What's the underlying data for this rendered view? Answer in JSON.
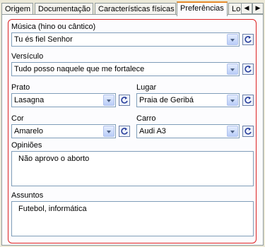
{
  "tabs": [
    {
      "label": "Origem"
    },
    {
      "label": "Documentação"
    },
    {
      "label": "Características físicas"
    },
    {
      "label": "Preferências"
    },
    {
      "label": "Lo"
    }
  ],
  "tab_scroll": {
    "left": "◀",
    "right": "▶"
  },
  "fields": {
    "musica": {
      "label": "Música (hino ou cântico)",
      "value": "Tu és fiel Senhor"
    },
    "versiculo": {
      "label": "Versículo",
      "value": "Tudo posso naquele que me fortalece"
    },
    "prato": {
      "label": "Prato",
      "value": "Lasagna"
    },
    "lugar": {
      "label": "Lugar",
      "value": "Praia de Geribá"
    },
    "cor": {
      "label": "Cor",
      "value": "Amarelo"
    },
    "carro": {
      "label": "Carro",
      "value": "Audi A3"
    },
    "opinioes": {
      "label": "Opiniões",
      "value": "Não aprovo o aborto"
    },
    "assuntos": {
      "label": "Assuntos",
      "value": "Futebol, informática"
    }
  },
  "colors": {
    "group_border": "#dd2222",
    "active_tab_accent": "#e68b2c",
    "refresh_arrow": "#2a3f9c"
  }
}
